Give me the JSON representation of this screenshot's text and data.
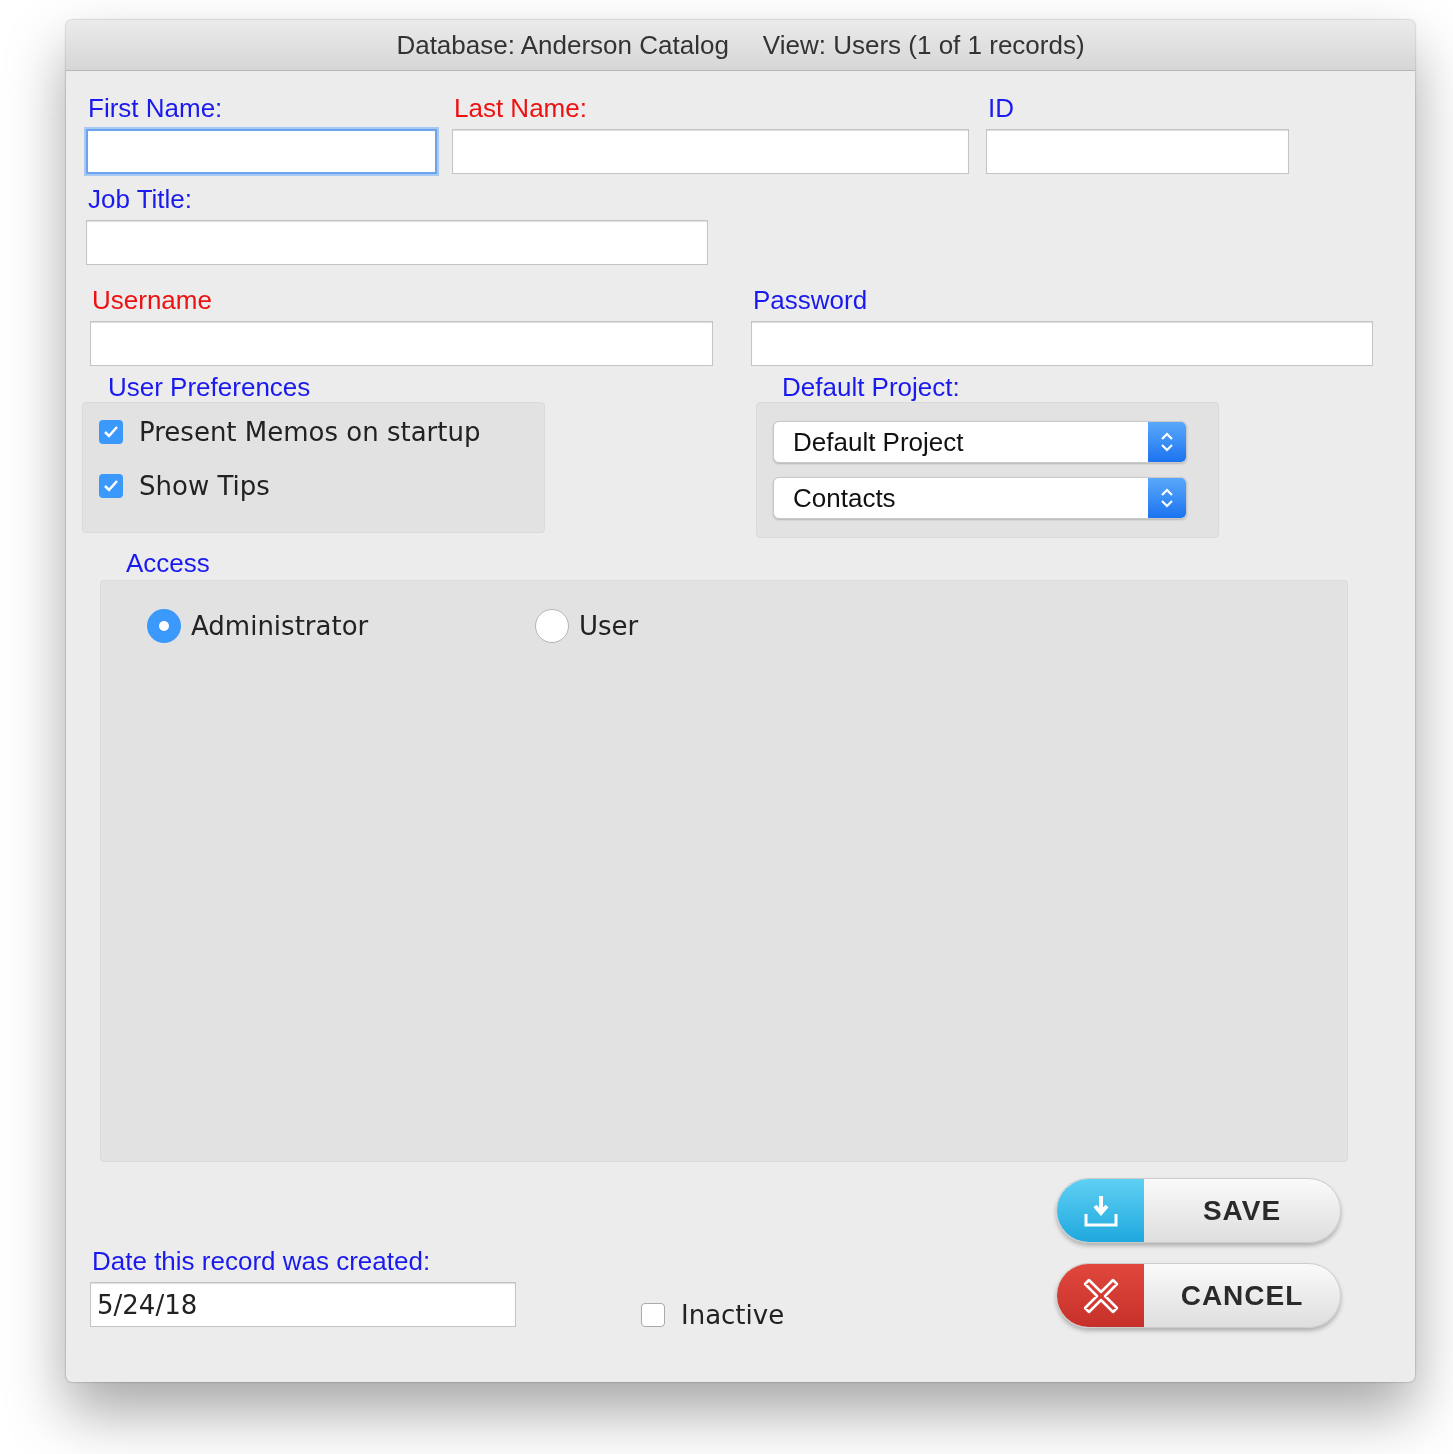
{
  "window": {
    "database": "Database: Anderson Catalog",
    "view": "View: Users (1 of 1 records)"
  },
  "fields": [
    {
      "label": "First Name:",
      "required": false,
      "focused": true
    },
    {
      "label": "Last Name:",
      "required": true,
      "focused": false
    },
    {
      "label": "ID",
      "required": false,
      "focused": false
    },
    {
      "label": "Job Title:",
      "required": false,
      "focused": false
    },
    {
      "label": "Username",
      "required": true,
      "focused": false
    },
    {
      "label": "Password",
      "required": false,
      "focused": false
    }
  ],
  "preferences": {
    "label": "User Preferences",
    "options": [
      {
        "label": "Present Memos on startup",
        "checked": true
      },
      {
        "label": "Show Tips",
        "checked": true
      }
    ]
  },
  "default_project": {
    "label": "Default Project:",
    "selects": [
      {
        "value": "Default Project"
      },
      {
        "value": "Contacts"
      }
    ]
  },
  "access": {
    "label": "Access",
    "options": [
      {
        "label": "Administrator",
        "selected": true
      },
      {
        "label": "User",
        "selected": false
      }
    ]
  },
  "created": {
    "label": "Date this record was created:",
    "value": "5/24/18"
  },
  "inactive": {
    "label": "Inactive",
    "checked": false
  },
  "buttons": [
    {
      "kind": "save",
      "label": "SAVE"
    },
    {
      "kind": "cancel",
      "label": "CANCEL"
    }
  ]
}
